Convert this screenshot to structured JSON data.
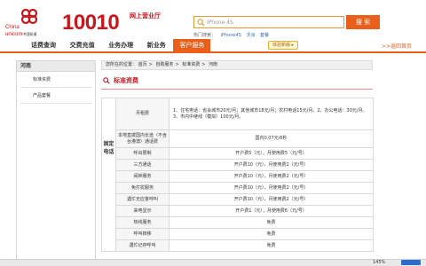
{
  "header": {
    "logo_en_1": "China",
    "logo_en_2": "unicom",
    "logo_cn": "中国联通",
    "brand": "10010",
    "brand_sub": "网上营业厅",
    "search": {
      "value": "iPhone 4S",
      "button_label": "搜 索"
    },
    "hot_search": {
      "label": "热门搜索：",
      "keywords": [
        "iPhone4S",
        "沃派",
        "套餐"
      ]
    },
    "colors": {
      "brand_red": "#c8161d",
      "accent_orange": "#e8601c"
    }
  },
  "nav": {
    "items": [
      "话费查询",
      "交费充值",
      "业务办理",
      "新业务",
      "客户服务"
    ],
    "active_index": 4,
    "pill": "体验新版 ▸",
    "back_home": ">>返回首页"
  },
  "sidebar": {
    "title": "河南",
    "items": [
      "标准资费",
      "产品套餐"
    ]
  },
  "breadcrumb": {
    "prefix": "您所在的位置：",
    "items": [
      "首页",
      "自助服务",
      "标准资费",
      "河南"
    ]
  },
  "section_title": "标准资费",
  "table": {
    "category_top": "固定",
    "category_bottom": "电话",
    "rows": [
      {
        "name": "月租费",
        "value": "1、住宅电话：省会城市20元/月；其他城市18元/月；农村电话15元/月。2、办公电话：30元/月。3、市内中继线（模拟）100元/月。"
      },
      {
        "name": "本地直拨国内长途（不含台港澳）通话费",
        "value": "国内0.07元/6秒"
      },
      {
        "name": "呼出限制",
        "value": "开户费5（元），月使用费5（元/号）"
      },
      {
        "name": "三方通话",
        "value": "开户费10（元），月使用费2（元/号）"
      },
      {
        "name": "闹钟服务",
        "value": "开户费10（元），月使用费2（元/号）"
      },
      {
        "name": "免打扰服务",
        "value": "开户费10（元），月使用费2（元/号）"
      },
      {
        "name": "遇忙无应答呼叫",
        "value": "开户费10（元），月使用费2（元/号）"
      },
      {
        "name": "来电显示",
        "value": "开户费1（元），月使用费6（元/号）"
      },
      {
        "name": "热线服务",
        "value": "免费"
      },
      {
        "name": "呼叫转移",
        "value": "免费"
      },
      {
        "name": "遇忙记存呼叫",
        "value": "免费"
      }
    ]
  },
  "status_bar": {
    "zoom": "145%"
  }
}
